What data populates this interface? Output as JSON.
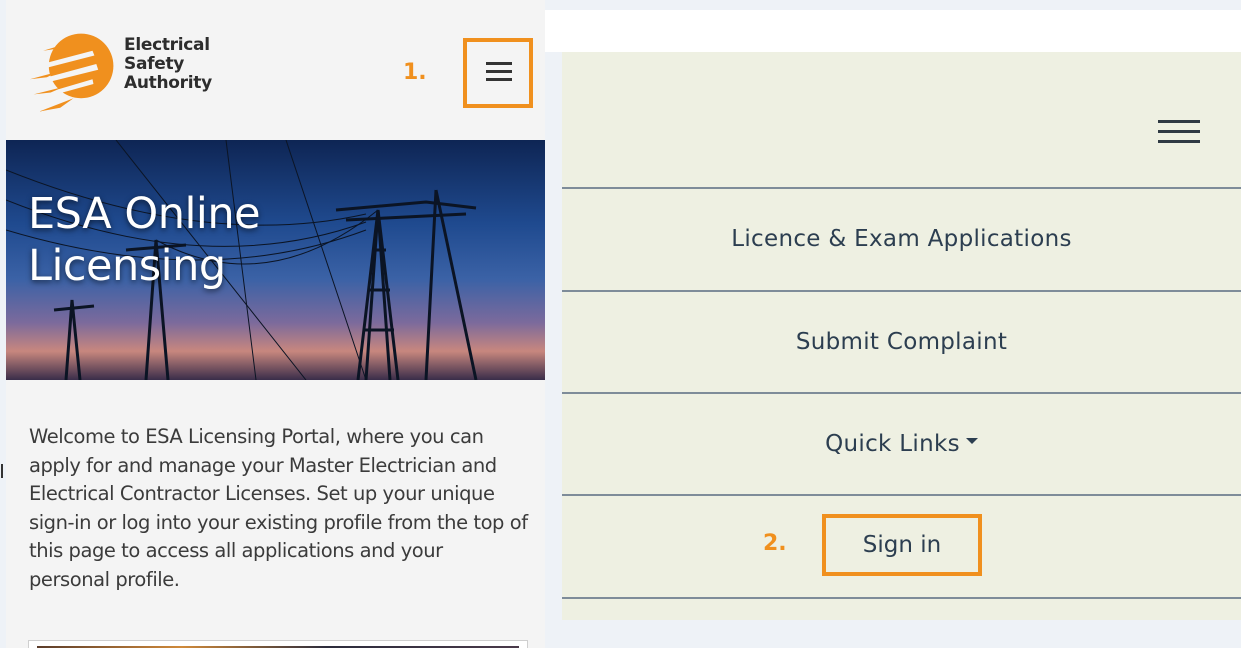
{
  "brand": {
    "line1": "Electrical",
    "line2": "Safety",
    "line3": "Authority",
    "logo_icon": "esa-flame-logo",
    "accent": "#f0901e"
  },
  "annotations": {
    "step1": "1.",
    "step2": "2.",
    "highlight_color": "#f0901e"
  },
  "hero": {
    "title_line1": "ESA Online",
    "title_line2": "Licensing"
  },
  "welcome_text": "Welcome to ESA Licensing Portal, where you can apply for and manage your Master Electrician and Electrical Contractor Licenses. Set up your unique sign-in or log into your existing profile from the top of this page to access all applications and your personal profile.",
  "menu": {
    "icon": "hamburger-icon",
    "items": [
      {
        "label": "Licence & Exam Applications"
      },
      {
        "label": "Submit Complaint"
      },
      {
        "label": "Quick Links"
      },
      {
        "label": "Sign in"
      }
    ],
    "quick_links_icon": "caret-down-icon",
    "background": "#eef0e2",
    "text_color": "#2c3e50"
  }
}
